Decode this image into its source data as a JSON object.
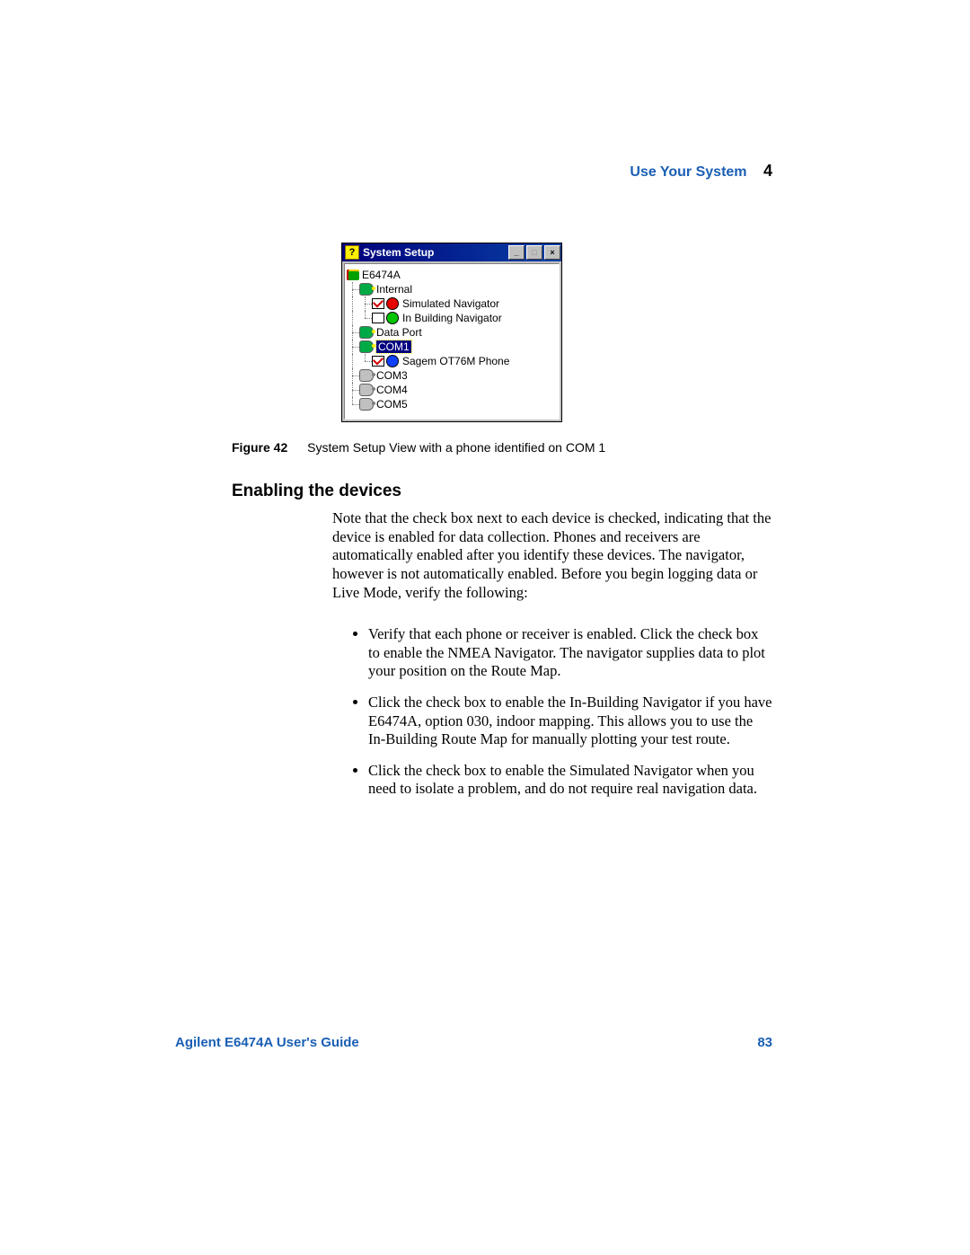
{
  "header": {
    "title": "Use Your System",
    "chapter": "4"
  },
  "window": {
    "title": "System Setup",
    "root": "E6474A",
    "internal": {
      "label": "Internal",
      "items": [
        {
          "label": "Simulated Navigator",
          "checked": true,
          "dot": "red"
        },
        {
          "label": "In Building Navigator",
          "checked": false,
          "dot": "grn"
        }
      ]
    },
    "dataport": {
      "label": "Data Port"
    },
    "com1": {
      "label": "COM1",
      "items": [
        {
          "label": "Sagem OT76M Phone",
          "checked": true,
          "dot": "blu"
        }
      ]
    },
    "ports": [
      "COM3",
      "COM4",
      "COM5"
    ]
  },
  "figure": {
    "num": "Figure 42",
    "caption": "System Setup View with a phone identified on COM 1"
  },
  "section": {
    "title": "Enabling the devices"
  },
  "paragraph": "Note that the check box next to each device is checked, indicating that the device is enabled for data collection. Phones and receivers are automatically enabled after you identify these devices. The navigator, however is not automatically enabled. Before you begin logging data or Live Mode, verify the following:",
  "bullets": [
    "Verify that each phone or receiver is enabled. Click the check box to enable the NMEA Navigator. The navigator supplies data to plot your position on the Route Map.",
    "Click the check box to enable the In-Building Navigator if you have E6474A, option 030, indoor mapping. This allows you to use the In-Building Route Map for manually plotting your test route.",
    "Click the check box to enable the Simulated Navigator when you need to isolate a problem, and do not require real navigation data."
  ],
  "footer": {
    "left": "Agilent E6474A User's Guide",
    "right": "83"
  }
}
